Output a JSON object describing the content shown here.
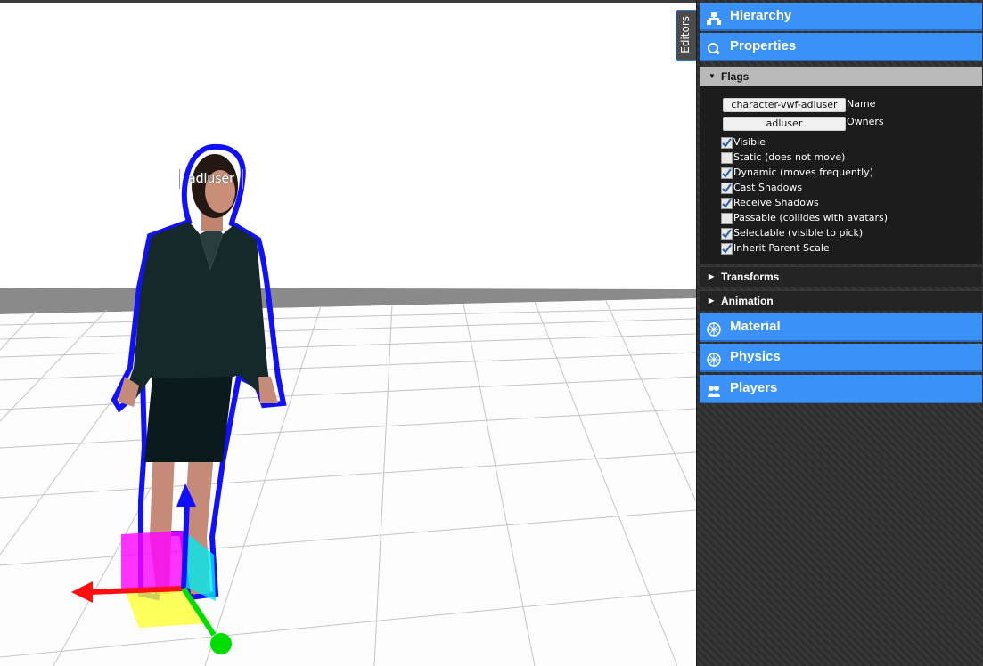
{
  "viewport": {
    "avatar_name": "adluser"
  },
  "editors_tab": {
    "label": "Editors"
  },
  "panel": {
    "hierarchy": {
      "label": "Hierarchy",
      "icon": "hierarchy-icon"
    },
    "properties": {
      "label": "Properties",
      "icon": "properties-icon"
    },
    "flags": {
      "header": "Flags",
      "name_value": "character-vwf-adluser",
      "name_label": "Name",
      "owners_value": "adluser",
      "owners_label": "Owners",
      "checkboxes": [
        {
          "label": "Visible",
          "checked": true
        },
        {
          "label": "Static (does not move)",
          "checked": false
        },
        {
          "label": "Dynamic (moves frequently)",
          "checked": true
        },
        {
          "label": "Cast Shadows",
          "checked": true
        },
        {
          "label": "Receive Shadows",
          "checked": true
        },
        {
          "label": "Passable (collides with avatars)",
          "checked": false
        },
        {
          "label": "Selectable (visible to pick)",
          "checked": true
        },
        {
          "label": "Inherit Parent Scale",
          "checked": true
        }
      ]
    },
    "transforms": {
      "label": "Transforms"
    },
    "animation": {
      "label": "Animation"
    },
    "material": {
      "label": "Material",
      "icon": "material-icon"
    },
    "physics": {
      "label": "Physics",
      "icon": "physics-icon"
    },
    "players": {
      "label": "Players",
      "icon": "players-icon"
    }
  },
  "colors": {
    "accent_blue": "#3a91f7",
    "panel_dark": "#1c1c1c",
    "selection_outline": "#1010ff"
  }
}
